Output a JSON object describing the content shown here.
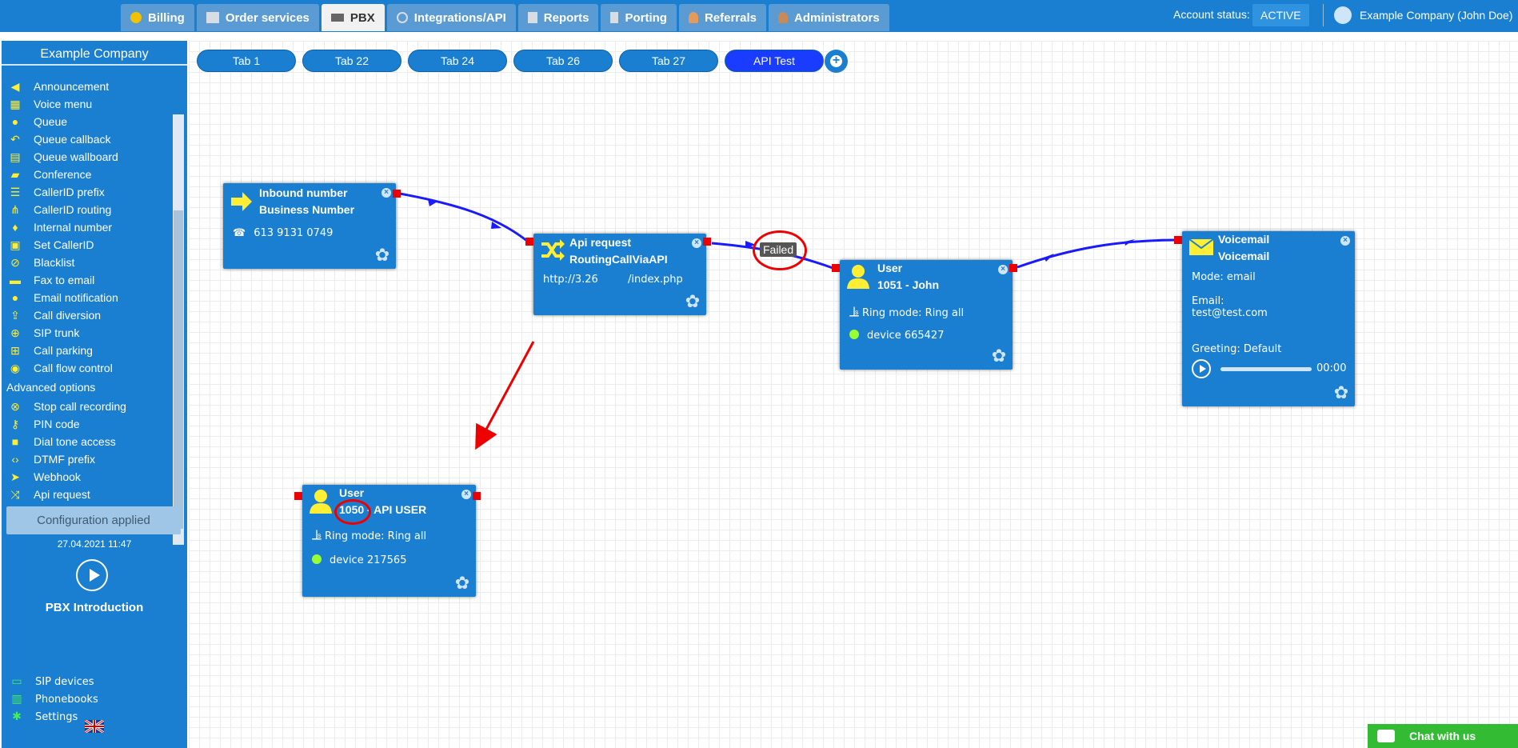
{
  "topnav": {
    "tabs": [
      {
        "label": "Billing",
        "icon": "coins-icon",
        "active": false
      },
      {
        "label": "Order services",
        "icon": "cart-icon",
        "active": false
      },
      {
        "label": "PBX",
        "icon": "pbx-icon",
        "active": true
      },
      {
        "label": "Integrations/API",
        "icon": "gear-icon",
        "active": false
      },
      {
        "label": "Reports",
        "icon": "report-icon",
        "active": false
      },
      {
        "label": "Porting",
        "icon": "phone-icon",
        "active": false
      },
      {
        "label": "Referrals",
        "icon": "person-icon",
        "active": false
      },
      {
        "label": "Administrators",
        "icon": "admin-icon",
        "active": false
      }
    ],
    "account_status_label": "Account status:",
    "account_status": "ACTIVE",
    "user": "Example Company (John Doe)"
  },
  "sidebar": {
    "company": "Example Company",
    "items": [
      {
        "label": "Announcement",
        "icon": "megaphone-icon"
      },
      {
        "label": "Voice menu",
        "icon": "grid-icon"
      },
      {
        "label": "Queue",
        "icon": "add-user-icon"
      },
      {
        "label": "Queue callback",
        "icon": "callback-icon"
      },
      {
        "label": "Queue wallboard",
        "icon": "table-icon"
      },
      {
        "label": "Conference",
        "icon": "chat-icon"
      },
      {
        "label": "CallerID prefix",
        "icon": "list-icon"
      },
      {
        "label": "CallerID routing",
        "icon": "routing-icon"
      },
      {
        "label": "Internal number",
        "icon": "pin-icon"
      },
      {
        "label": "Set CallerID",
        "icon": "id-card-icon"
      },
      {
        "label": "Blacklist",
        "icon": "ban-icon"
      },
      {
        "label": "Fax to email",
        "icon": "fax-icon"
      },
      {
        "label": "Email notification",
        "icon": "email-icon"
      },
      {
        "label": "Call diversion",
        "icon": "upload-icon"
      },
      {
        "label": "SIP trunk",
        "icon": "globe-icon"
      },
      {
        "label": "Call parking",
        "icon": "cart-icon"
      },
      {
        "label": "Call flow control",
        "icon": "toggle-icon"
      }
    ],
    "advanced_label": "Advanced options",
    "advanced_items": [
      {
        "label": "Stop call recording",
        "icon": "mic-off-icon"
      },
      {
        "label": "PIN code",
        "icon": "key-icon"
      },
      {
        "label": "Dial tone access",
        "icon": "lock-icon"
      },
      {
        "label": "DTMF prefix",
        "icon": "code-icon"
      },
      {
        "label": "Webhook",
        "icon": "send-icon"
      },
      {
        "label": "Api request",
        "icon": "shuffle-icon"
      }
    ],
    "config_status": "Configuration applied",
    "config_time": "27.04.2021 11:47",
    "intro": "PBX Introduction",
    "bottom_items": [
      {
        "label": "SIP devices",
        "icon": "monitor-icon"
      },
      {
        "label": "Phonebooks",
        "icon": "book-icon"
      },
      {
        "label": "Settings",
        "icon": "gear-icon"
      }
    ]
  },
  "tabs": [
    "Tab 1",
    "Tab 22",
    "Tab 24",
    "Tab 26",
    "Tab 27",
    "API Test"
  ],
  "active_tab": "API Test",
  "nodes": {
    "inbound": {
      "type": "Inbound number",
      "name": "Business Number",
      "number": "613 9131 0749"
    },
    "api": {
      "type": "Api request",
      "name": "RoutingCallViaAPI",
      "url": "http://3.26         /index.php"
    },
    "user1": {
      "type": "User",
      "name": "1051 - John",
      "ring": "Ring mode: Ring all",
      "device": "device 665427"
    },
    "voicemail": {
      "type": "Voicemail",
      "name": "Voicemail",
      "mode": "Mode: email",
      "email_label": "Email:",
      "email": "test@test.com",
      "greeting": "Greeting: Default",
      "time": "00:00"
    },
    "user2": {
      "type": "User",
      "ext": "1050",
      "name_rest": " - API USER",
      "ring": "Ring mode: Ring all",
      "device": "device 217565"
    }
  },
  "failed_label": "Failed",
  "chat": "Chat with us",
  "colors": {
    "primary": "#1a7fd1",
    "accent_yellow": "#ffee33",
    "wire": "#1a1aff",
    "annotation": "#e00000",
    "chat": "#33bb33"
  }
}
